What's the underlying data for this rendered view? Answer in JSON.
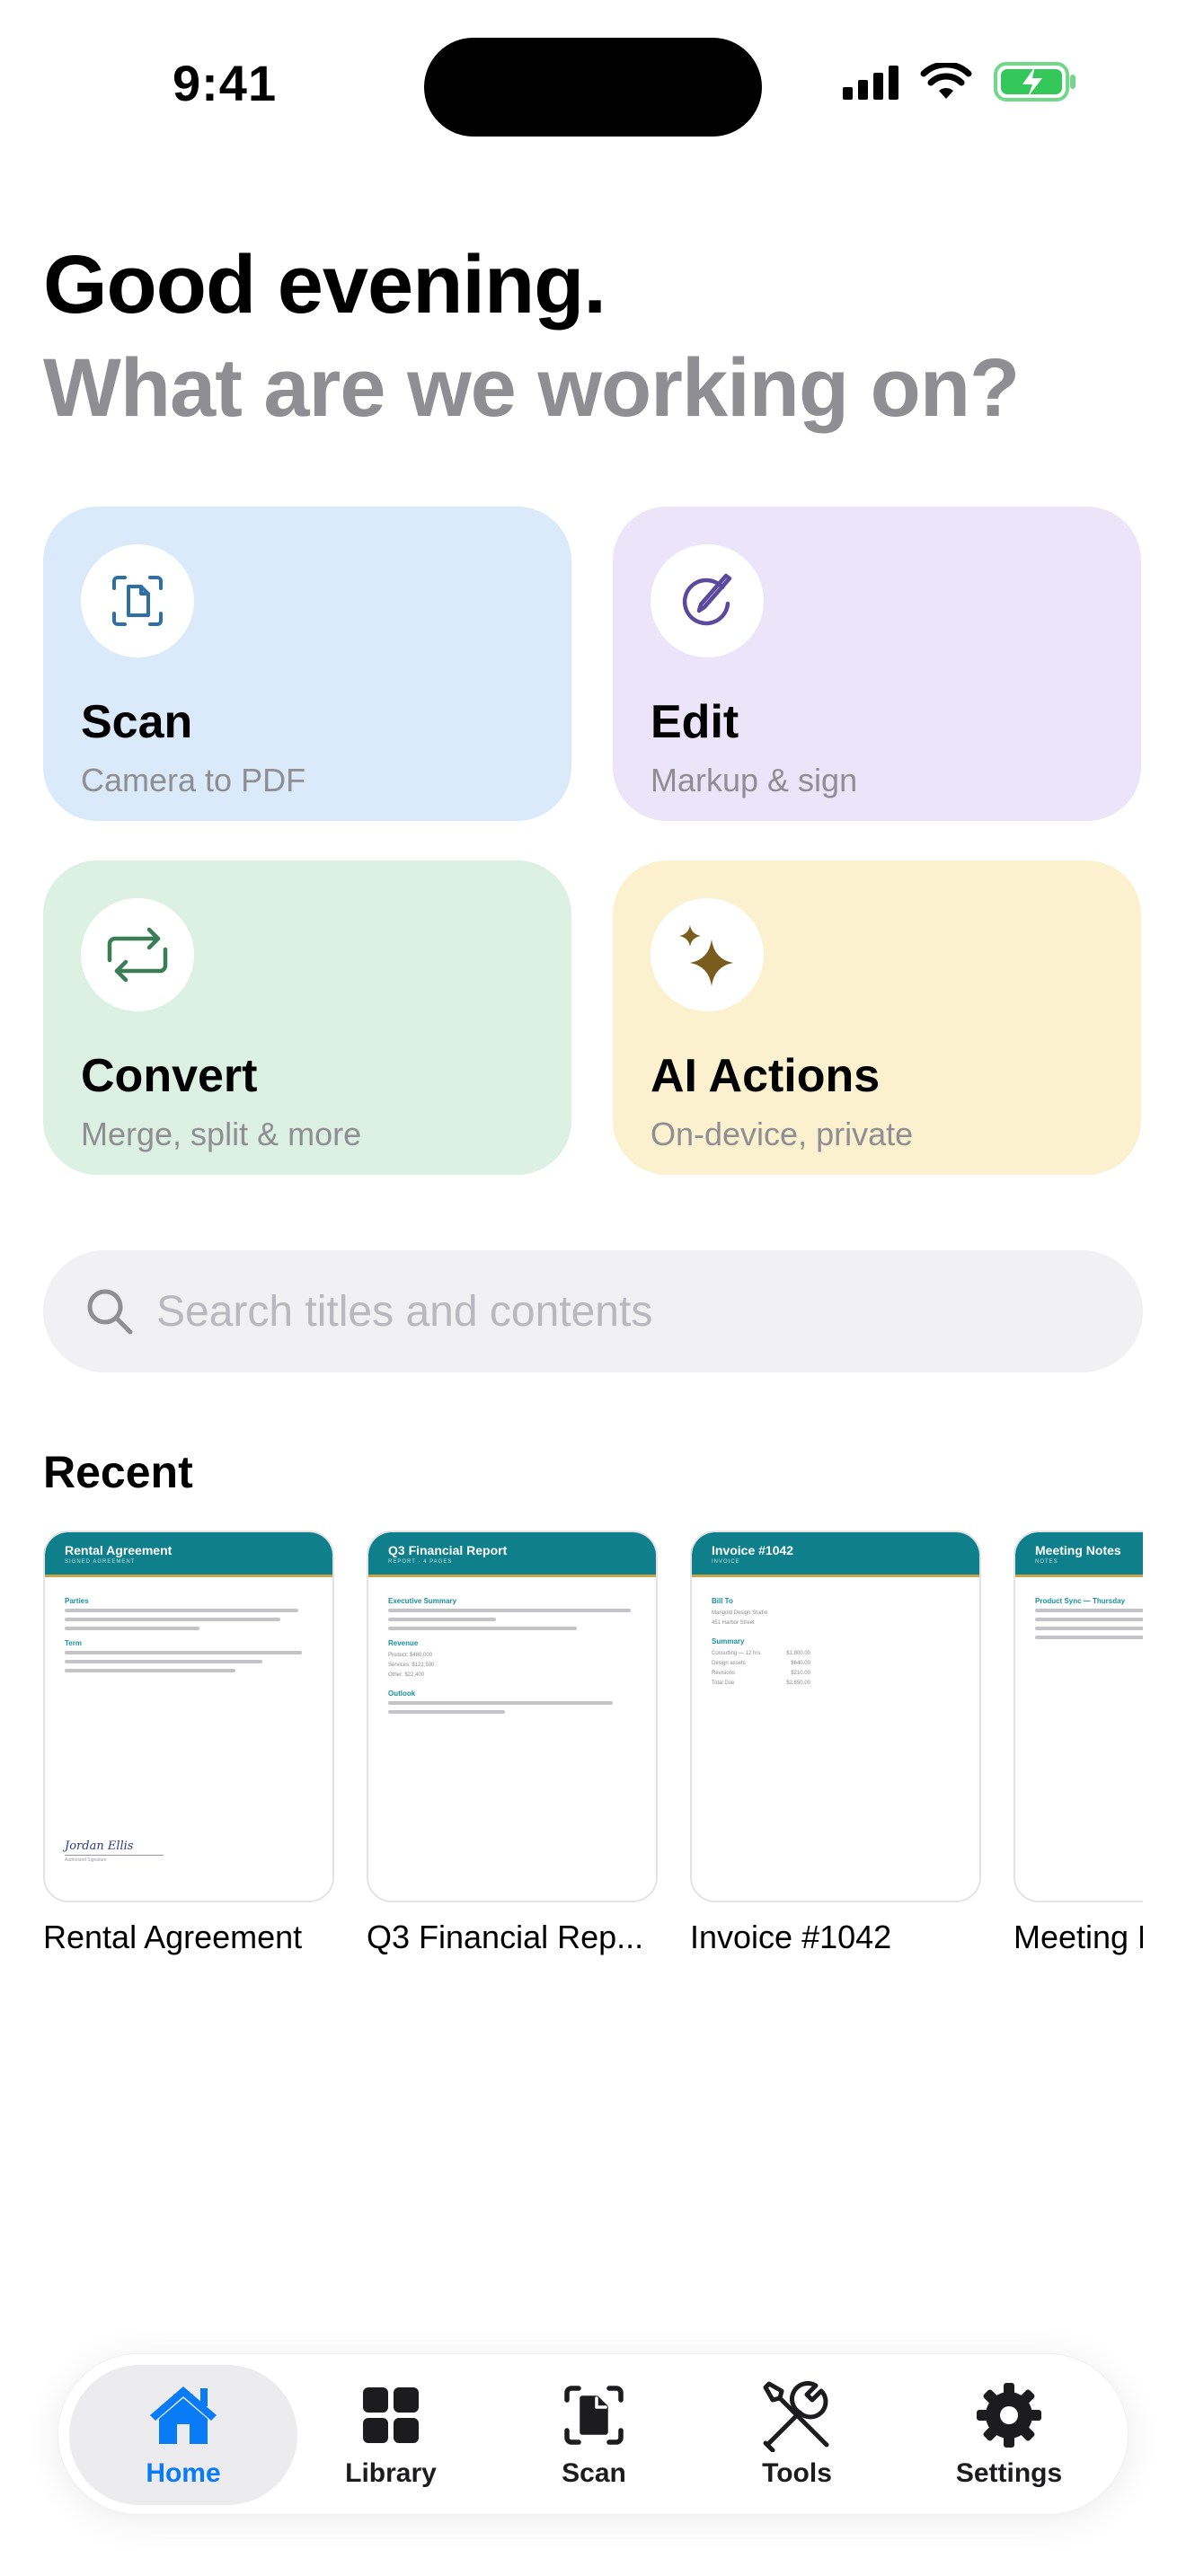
{
  "status_bar": {
    "time": "9:41"
  },
  "greeting": {
    "line1": "Good evening.",
    "line2": "What are we working on?"
  },
  "actions": [
    {
      "title": "Scan",
      "subtitle": "Camera to PDF",
      "icon": "scan-document-icon",
      "bg": "#dbeafa",
      "icon_color": "#2f6fa8"
    },
    {
      "title": "Edit",
      "subtitle": "Markup & sign",
      "icon": "pen-circle-icon",
      "bg": "#ece4f8",
      "icon_color": "#5a4a9e"
    },
    {
      "title": "Convert",
      "subtitle": "Merge, split & more",
      "icon": "convert-arrows-icon",
      "bg": "#dcf0e3",
      "icon_color": "#3a7d56"
    },
    {
      "title": "AI Actions",
      "subtitle": "On-device, private",
      "icon": "sparkles-icon",
      "bg": "#fbf1cf",
      "icon_color": "#7a5c1e"
    }
  ],
  "search": {
    "placeholder": "Search titles and contents"
  },
  "recent": {
    "title": "Recent",
    "docs": [
      {
        "name": "Rental Agreement",
        "thumb_title": "Rental Agreement",
        "thumb_subtitle": "SIGNED AGREEMENT",
        "sections": [
          "Parties",
          "Term"
        ],
        "signature": "Jordan Ellis",
        "signature_caption": "Authorized Signature"
      },
      {
        "name": "Q3 Financial Rep...",
        "thumb_title": "Q3 Financial Report",
        "thumb_subtitle": "REPORT · 4 PAGES",
        "sections": [
          "Executive Summary",
          "Revenue",
          "Outlook"
        ],
        "figures": [
          "Product: $480,000",
          "Services: $121,500",
          "Other: $22,400"
        ]
      },
      {
        "name": "Invoice #1042",
        "thumb_title": "Invoice #1042",
        "thumb_subtitle": "INVOICE",
        "sections": [
          "Bill To",
          "Summary"
        ],
        "bill_to": [
          "Marigold Design Studio",
          "451 Harbor Street"
        ],
        "lines": [
          {
            "label": "Consulting — 12 hrs",
            "amount": "$1,800.00"
          },
          {
            "label": "Design assets",
            "amount": "$640.00"
          },
          {
            "label": "Revisions",
            "amount": "$210.00"
          },
          {
            "label": "Total Due",
            "amount": "$2,650.00"
          }
        ]
      },
      {
        "name": "Meeting Notes",
        "thumb_title": "Meeting Notes",
        "thumb_subtitle": "NOTES",
        "sections": [
          "Product Sync — Thursday"
        ]
      }
    ]
  },
  "tabbar": {
    "active": "Home",
    "tabs": [
      {
        "label": "Home",
        "icon": "house-icon"
      },
      {
        "label": "Library",
        "icon": "grid-icon"
      },
      {
        "label": "Scan",
        "icon": "scan-icon"
      },
      {
        "label": "Tools",
        "icon": "tools-icon"
      },
      {
        "label": "Settings",
        "icon": "gear-icon"
      }
    ]
  },
  "colors": {
    "accent": "#0a7bf6",
    "doc_header": "#0f7f8c",
    "muted_text": "#8e8e93"
  }
}
